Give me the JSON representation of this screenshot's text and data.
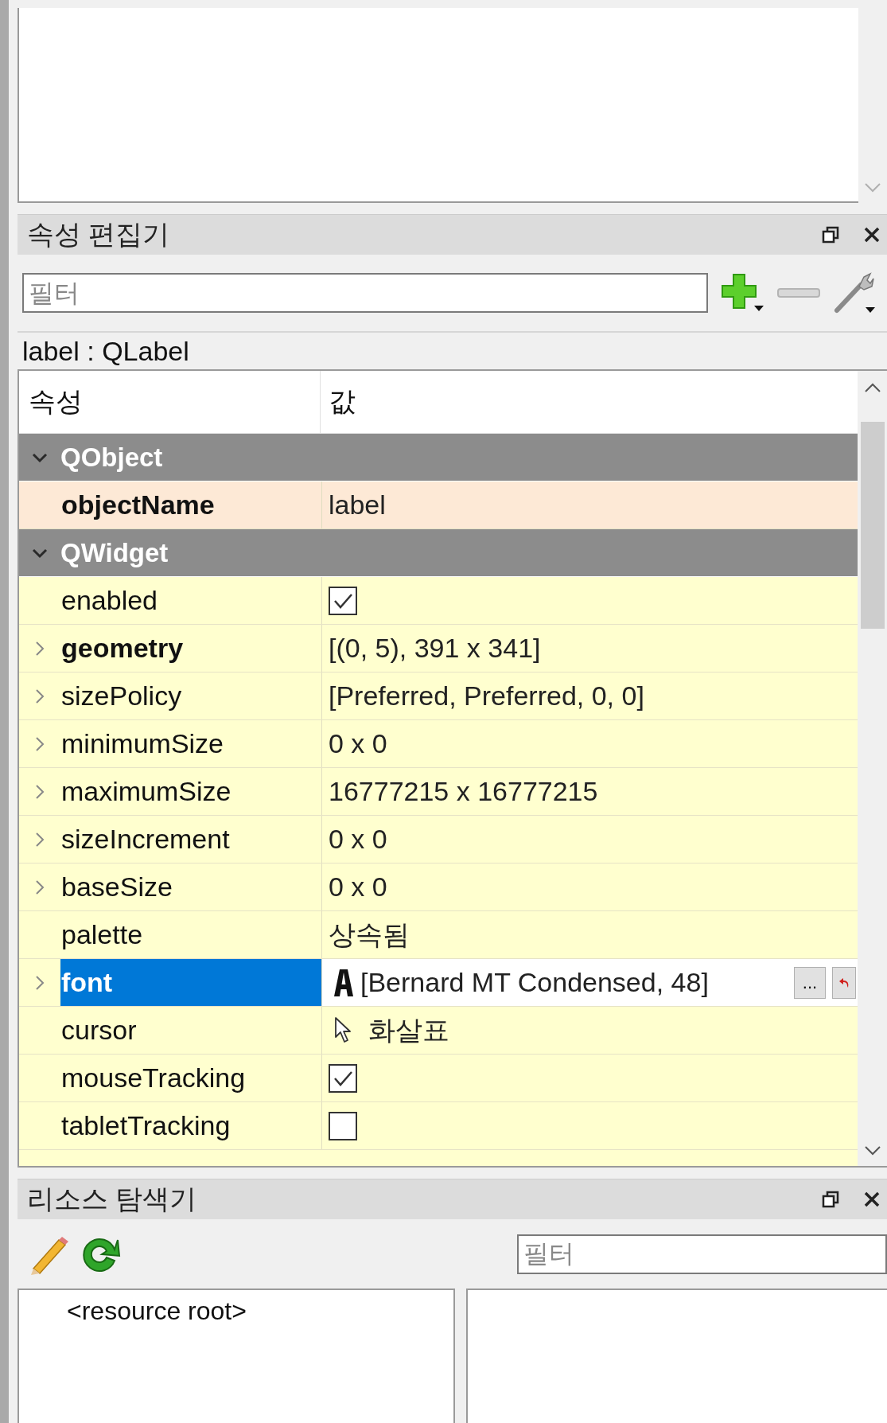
{
  "property_editor": {
    "title": "속성 편집기",
    "filter": {
      "placeholder": "필터"
    },
    "object_label": "label : QLabel",
    "table": {
      "columns": [
        "속성",
        "값"
      ],
      "sections": [
        {
          "name": "QObject",
          "expanded": true,
          "color": "#fde9d6",
          "properties": [
            {
              "name": "objectName",
              "bold": true,
              "kind": "text",
              "value": "label",
              "selected": false
            }
          ]
        },
        {
          "name": "QWidget",
          "expanded": true,
          "color": "#ffffcf",
          "properties": [
            {
              "name": "enabled",
              "bold": false,
              "kind": "checkbox",
              "checked": true,
              "selected": false
            },
            {
              "name": "geometry",
              "bold": true,
              "expanded": false,
              "kind": "text",
              "value": "[(0, 5), 391 x 341]",
              "selected": false
            },
            {
              "name": "sizePolicy",
              "bold": false,
              "expanded": false,
              "kind": "text",
              "value": "[Preferred, Preferred, 0, 0]",
              "selected": false
            },
            {
              "name": "minimumSize",
              "bold": false,
              "expanded": false,
              "kind": "text",
              "value": "0 x 0",
              "selected": false
            },
            {
              "name": "maximumSize",
              "bold": false,
              "expanded": false,
              "kind": "text",
              "value": "16777215 x 16777215",
              "selected": false
            },
            {
              "name": "sizeIncrement",
              "bold": false,
              "expanded": false,
              "kind": "text",
              "value": "0 x 0",
              "selected": false
            },
            {
              "name": "baseSize",
              "bold": false,
              "expanded": false,
              "kind": "text",
              "value": "0 x 0",
              "selected": false
            },
            {
              "name": "palette",
              "bold": false,
              "kind": "text",
              "value": "상속됨",
              "selected": false
            },
            {
              "name": "font",
              "bold": true,
              "expanded": false,
              "kind": "font",
              "value": "[Bernard MT Condensed, 48]",
              "more": "...",
              "selected": true
            },
            {
              "name": "cursor",
              "bold": false,
              "kind": "cursor",
              "value": "화살표",
              "selected": false
            },
            {
              "name": "mouseTracking",
              "bold": false,
              "kind": "checkbox",
              "checked": true,
              "selected": false
            },
            {
              "name": "tabletTracking",
              "bold": false,
              "kind": "checkbox",
              "checked": false,
              "selected": false
            }
          ]
        }
      ]
    }
  },
  "resource_browser": {
    "title": "리소스 탐색기",
    "filter": {
      "placeholder": "필터"
    },
    "tree": [
      "<resource root>"
    ]
  }
}
